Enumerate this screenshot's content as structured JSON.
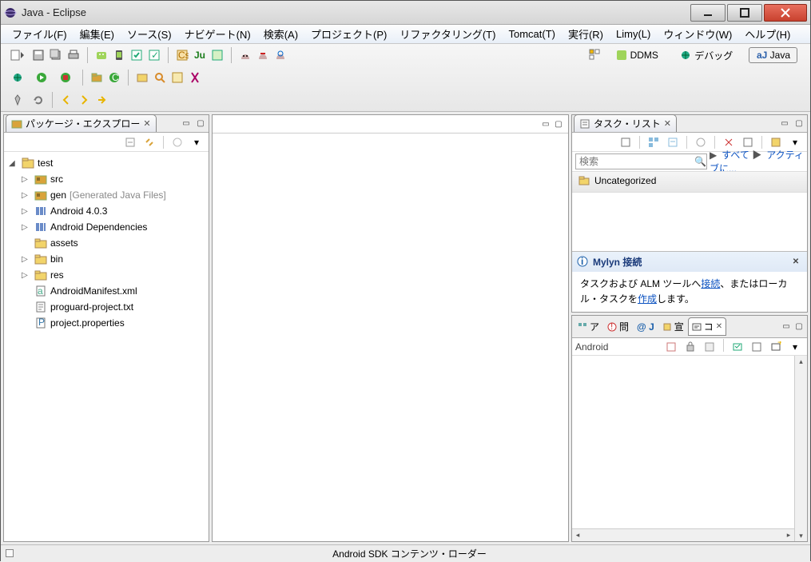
{
  "title": "Java - Eclipse",
  "menu": [
    "ファイル(F)",
    "編集(E)",
    "ソース(S)",
    "ナビゲート(N)",
    "検索(A)",
    "プロジェクト(P)",
    "リファクタリング(T)",
    "Tomcat(T)",
    "実行(R)",
    "Limy(L)",
    "ウィンドウ(W)",
    "ヘルプ(H)"
  ],
  "perspectives": {
    "ddms": "DDMS",
    "debug": "デバッグ",
    "java": "Java"
  },
  "package_explorer": {
    "title": "パッケージ・エクスプロー",
    "root": "test",
    "children": [
      {
        "label": "src",
        "icon": "package-folder",
        "expandable": true
      },
      {
        "label": "gen",
        "suffix": "[Generated Java Files]",
        "icon": "package-folder",
        "expandable": true
      },
      {
        "label": "Android 4.0.3",
        "icon": "library",
        "expandable": true
      },
      {
        "label": "Android Dependencies",
        "icon": "library",
        "expandable": true
      },
      {
        "label": "assets",
        "icon": "folder",
        "expandable": false
      },
      {
        "label": "bin",
        "icon": "folder",
        "expandable": true
      },
      {
        "label": "res",
        "icon": "folder",
        "expandable": true
      },
      {
        "label": "AndroidManifest.xml",
        "icon": "file-xml",
        "expandable": false
      },
      {
        "label": "proguard-project.txt",
        "icon": "file-txt",
        "expandable": false
      },
      {
        "label": "project.properties",
        "icon": "file-props",
        "expandable": false
      }
    ]
  },
  "tasks": {
    "title": "タスク・リスト",
    "search_placeholder": "検索",
    "link_all": "すべて",
    "link_active": "アクティブに...",
    "category": "Uncategorized",
    "mylyn_title": "Mylyn 接続",
    "mylyn_body_pre": "タスクおよび ALM ツールへ",
    "mylyn_link1": "接続",
    "mylyn_body_mid": "、またはローカル・タスクを",
    "mylyn_link2": "作成",
    "mylyn_body_post": "します。"
  },
  "bottom_tabs": {
    "t0": "ア",
    "t1": "問",
    "t2": "@ J",
    "t3": "宣",
    "t4": "コ"
  },
  "console": {
    "label": "Android"
  },
  "status": {
    "center": "Android SDK コンテンツ・ローダー"
  }
}
